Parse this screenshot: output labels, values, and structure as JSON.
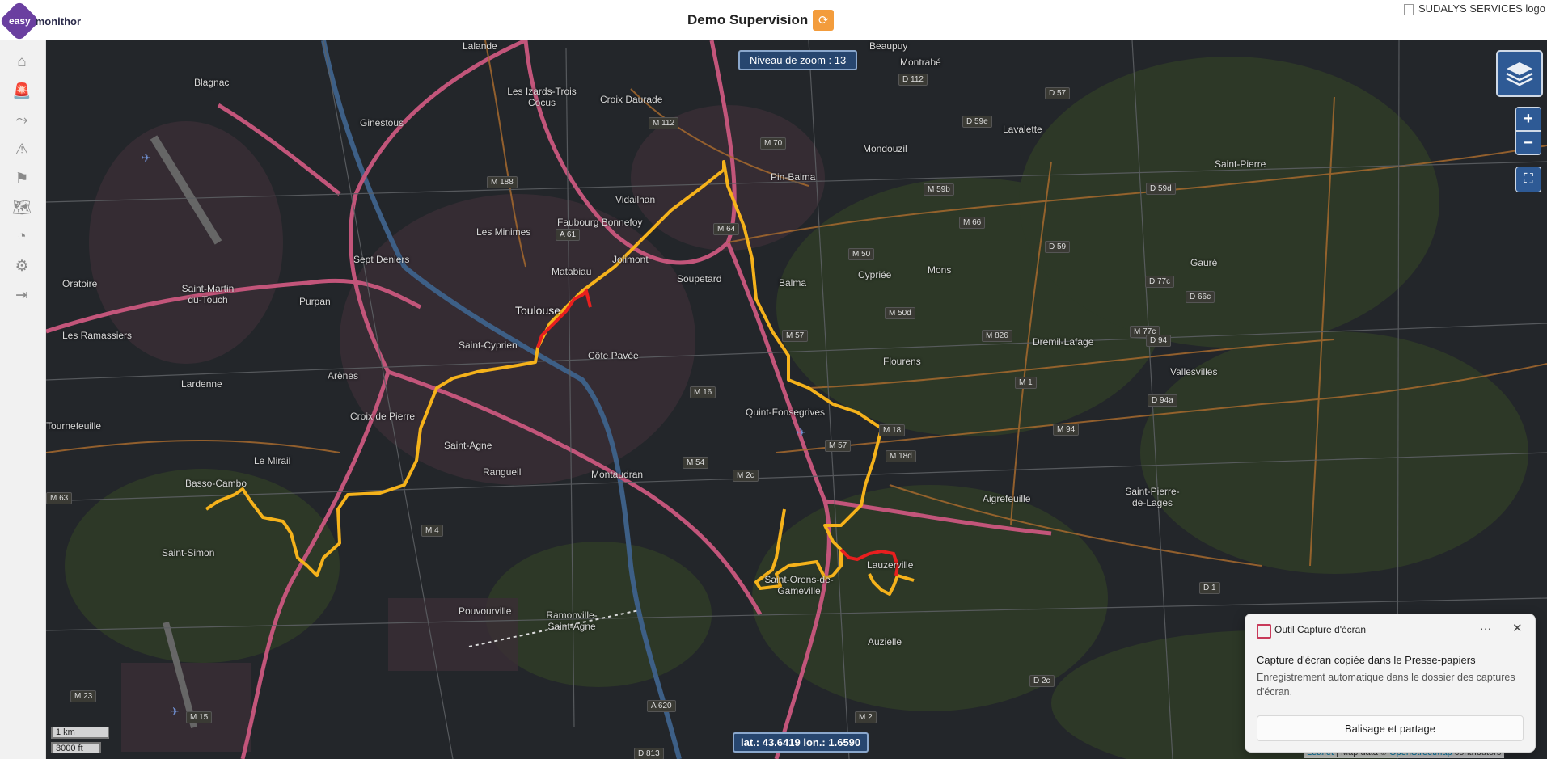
{
  "header": {
    "logo_easy": "easy",
    "logo_monithor": "monithor",
    "title": "Demo Supervision",
    "brand_logo_alt": "SUDALYS SERVICES logo"
  },
  "sidebar": {
    "icons": [
      "home-icon",
      "alarm-icon",
      "route-icon",
      "hazard-icon",
      "warning-flag-icon",
      "map-icon",
      "dashboard-icon",
      "settings-icon",
      "logout-icon"
    ]
  },
  "map": {
    "zoom_label": "Niveau de zoom : 13",
    "coords": "lat.: 43.6419 lon.: 1.6590",
    "scale_km": "1 km",
    "scale_ft": "3000 ft",
    "attribution_leaflet": "Leaflet",
    "attribution_text": " | Map data © ",
    "attribution_osm": "OpenStreetMap",
    "attribution_contrib": " contributors",
    "places": [
      "Blagnac",
      "Ginestous",
      "Lalande",
      "Les Izards-Trois Cocus",
      "Croix Daurade",
      "Beaupuy",
      "Montrabé",
      "Les Minimes",
      "Faubourg Bonnefoy",
      "Sept Deniers",
      "Matabiau",
      "Jolimont",
      "Soupetard",
      "Balma",
      "Cypriée",
      "Toulouse",
      "Saint-Cyprien",
      "Côte Pavée",
      "Purpan",
      "Oratoire",
      "Saint-Martin du-Touch",
      "Les Ramassiers",
      "Lardenne",
      "Arènes",
      "Croix de Pierre",
      "Saint-Agne",
      "Rangueil",
      "Montaudran",
      "Tournefeuille",
      "Le Mirail",
      "Basso-Cambo",
      "Saint-Simon",
      "Pouvourville",
      "Ramonville-Saint-Agne",
      "Quint-Fonsegrives",
      "Flourens",
      "Mons",
      "Mondouzil",
      "Pin-Balma",
      "Vidailhan",
      "Lavalette",
      "Dremil-Lafage",
      "Aigrefeuille",
      "Saint-Orens-de-Gameville",
      "Lauzerville",
      "Auzielle",
      "Gauré",
      "Vallesvilles",
      "Saint-Pierre-de-Lages",
      "Saint-Pierre"
    ],
    "roads": [
      "M 188",
      "A 61",
      "M 112",
      "M 70",
      "D 57",
      "D 59e",
      "D 112",
      "M 59b",
      "D 59d",
      "M 64",
      "M 66",
      "D 59",
      "M 50",
      "D 77c",
      "M 50d",
      "D 66c",
      "M 57",
      "M 77c",
      "M 826",
      "D 94",
      "M 16",
      "M 1",
      "D 94a",
      "M 18",
      "M 94",
      "M 57",
      "M 18d",
      "M 54",
      "M 2c",
      "M 4",
      "M 63",
      "M 23",
      "M 15",
      "A 620",
      "M 2",
      "D 2c",
      "D 813",
      "D 1"
    ]
  },
  "toast": {
    "app_name": "Outil Capture d'écran",
    "more": "···",
    "title": "Capture d'écran copiée dans le Presse-papiers",
    "body": "Enregistrement automatique dans le dossier des captures d'écran.",
    "action": "Balisage et partage"
  },
  "colors": {
    "track_orange": "#f5b21b",
    "track_red": "#e81f1f",
    "map_bg": "#23262a",
    "motorway": "#c2557a",
    "control_blue": "#2e5a95"
  }
}
